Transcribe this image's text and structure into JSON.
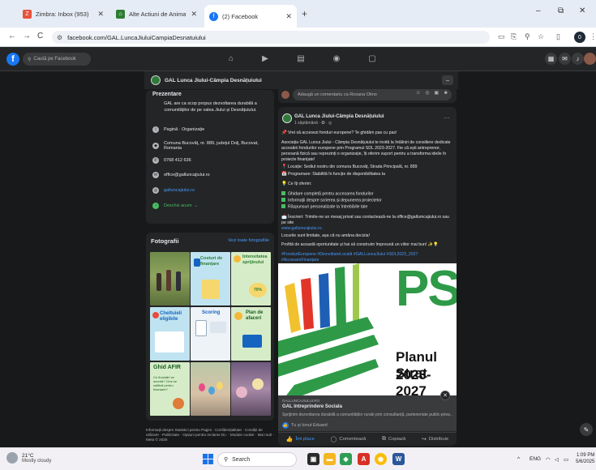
{
  "browser": {
    "tabs": [
      {
        "title": "Zimbra: Inbox (953)",
        "icon": "zimbra-icon",
        "color": "#e8513c"
      },
      {
        "title": "Alte Actiuni de Animare – Mari…",
        "icon": "sheet-icon",
        "color": "#2e7d32"
      },
      {
        "title": "(2) Facebook",
        "icon": "facebook-icon",
        "color": "#1877f2"
      }
    ],
    "new_tab": "+",
    "window_controls": {
      "minimize": "–",
      "restore": "⧉",
      "close": "✕"
    },
    "nav": {
      "back": "←",
      "forward": "→",
      "reload": "C"
    },
    "url": "facebook.com/GAL.LuncaJiuluiCampiaDesnatuiului",
    "profile_initial": "0"
  },
  "fb_nav": {
    "logo": "f",
    "search_placeholder": "Caută pe Facebook",
    "right_notification_badge": ""
  },
  "page": {
    "name": "GAL Lunca Jiului-Câmpia Desnățuiului",
    "more_button": "–"
  },
  "intro": {
    "title": "Prezentare",
    "description": "GAL are ca scop propus dezvoltarea durabilă a comunităților de pe valea Jiului și Desnățuiului.",
    "rows": [
      {
        "label": "Pagină · Organizație",
        "icon": "info-icon"
      },
      {
        "label": "Comuna Bucovăț, nr. 889, județul Dolj, Bucovat, Romania",
        "icon": "location-icon"
      },
      {
        "label": "0768 412 636",
        "icon": "phone-icon"
      },
      {
        "label": "office@galluncajiului.ro",
        "icon": "email-icon"
      },
      {
        "label": "galluncajiului.ro",
        "icon": "globe-icon"
      },
      {
        "label": "Deschis acum",
        "icon": "clock-icon"
      }
    ]
  },
  "photos": {
    "title": "Fotografii",
    "see_all": "Vezi toate fotografiile",
    "tiles": [
      {
        "text": "",
        "name": "photo-field-people"
      },
      {
        "text": "Costuri de finanțare",
        "name": "photo-costuri-finantare"
      },
      {
        "text": "Intensitatea sprijinului",
        "name": "photo-intensitatea-sprijinului"
      },
      {
        "text": "Cheltuieli eligibile",
        "name": "photo-cheltuieli-eligibile"
      },
      {
        "text": "Scoring",
        "name": "photo-scoring"
      },
      {
        "text": "Plan de afaceri",
        "name": "photo-plan-afaceri"
      },
      {
        "text": "Ghid AFIR",
        "name": "photo-ghid-afir"
      },
      {
        "text": "",
        "name": "photo-easter-eggs"
      },
      {
        "text": "",
        "name": "photo-crafts"
      }
    ],
    "tile_sub": {
      "intensitatea": "70%",
      "ghid_afir": "Ce finanțări se acordă? Cine se califică pentru finanțare?"
    }
  },
  "footer_links": "Informații despre Statistici pentru Pagini · Confidențialitate · Condiții de utilizare · Publicitate · Opțiuni pentru reclame D▷ · Module cookie · Mai mult · Meta © 2025",
  "comment_strip": {
    "placeholder": "Adaugă un comentariu ca Roxana Olmo",
    "icons": "☺ ◎ ▣ ☻"
  },
  "post": {
    "author": "GAL Lunca Jiului-Câmpia Desnățuiului",
    "time": "1 săptămână · ✪ · ◎",
    "more": "···",
    "lines": [
      {
        "kind": "text",
        "emoji": "📌",
        "text": "Vrei să accesezi fonduri europene? Te ghidăm pas cu pas!"
      },
      {
        "kind": "text",
        "emoji": "",
        "text": "Asociația GAL Lunca Jiului - Câmpia Desnățuiului te invită la întâlniri de consiliere dedicate accesării fondurilor europene prin Programul SDL 2023-2027. Fie că ești antreprenor, persoană fizică sau reprezinți o organizație, îți oferim suport pentru a transforma ideile în proiecte finanțate!"
      },
      {
        "kind": "text",
        "emoji": "📍",
        "text": "Locație: Sediul nostru din comuna Bucovăț, Strada Principală, nr. 889"
      },
      {
        "kind": "text",
        "emoji": "📅",
        "text": "Programare: Stabilită în funcție de disponibilitatea ta"
      },
      {
        "kind": "text",
        "emoji": "💡",
        "text": "Ce îți oferim:"
      },
      {
        "kind": "bullet",
        "emoji": "",
        "text": "Ghidare completă pentru accesarea fondurilor"
      },
      {
        "kind": "bullet",
        "emoji": "",
        "text": "Informații despre scrierea și depunerea proiectelor"
      },
      {
        "kind": "bullet",
        "emoji": "",
        "text": "Răspunsuri personalizate la întrebările tale"
      },
      {
        "kind": "text",
        "emoji": "📩",
        "text": "Înscrieri: Trimite-ne un mesaj privat sau contactează-ne la office@gallumcajiului.ro sau pe site"
      },
      {
        "kind": "link",
        "emoji": "",
        "text": "www.gallumcajiului.ro ."
      },
      {
        "kind": "text",
        "emoji": "",
        "text": "Locurile sunt limitate, așa că nu amâna decizia!"
      },
      {
        "kind": "text",
        "emoji": "",
        "text": "Profită de această oportunitate și hai să construim împreună un viitor mai bun! ✨💡"
      },
      {
        "kind": "hash",
        "emoji": "",
        "text": "#FonduriEuropene #DezvoltareLocală #GALLuncaJiului #SDL2023_2027 #AccesareFinanțare"
      }
    ],
    "image_text": {
      "ps": "PS",
      "subtitle": "Planul Strat",
      "years": "2023-2027"
    },
    "link": {
      "domain": "GALLUNCAJIULUI.RO",
      "title": "GAL Intreprindere Sociala",
      "description": "Sprijinim dezvoltarea durabilă a comunităților rurale prin consultanță, parteneriate public-priva…",
      "badge": "✕"
    },
    "reactions": "Tu și Ionut Eduard",
    "actions": [
      {
        "label": "Îmi place",
        "icon": "like-icon",
        "glyph": "👍"
      },
      {
        "label": "Comentează",
        "icon": "comment-icon",
        "glyph": "◯"
      },
      {
        "label": "Copiază",
        "icon": "copy-icon",
        "glyph": "⧉"
      },
      {
        "label": "Distribuie",
        "icon": "share-icon",
        "glyph": "↪"
      }
    ]
  },
  "taskbar": {
    "weather_temp": "21°C",
    "weather_desc": "Mostly cloudy",
    "search_placeholder": "Search",
    "lang": "ENG",
    "time": "1:09 PM",
    "date": "5/6/2025",
    "tray_arrow": "^"
  },
  "colors": {
    "fb_blue": "#1877f2",
    "dark_bg": "#18191a",
    "card_bg": "#242526",
    "green": "#45bd62"
  }
}
